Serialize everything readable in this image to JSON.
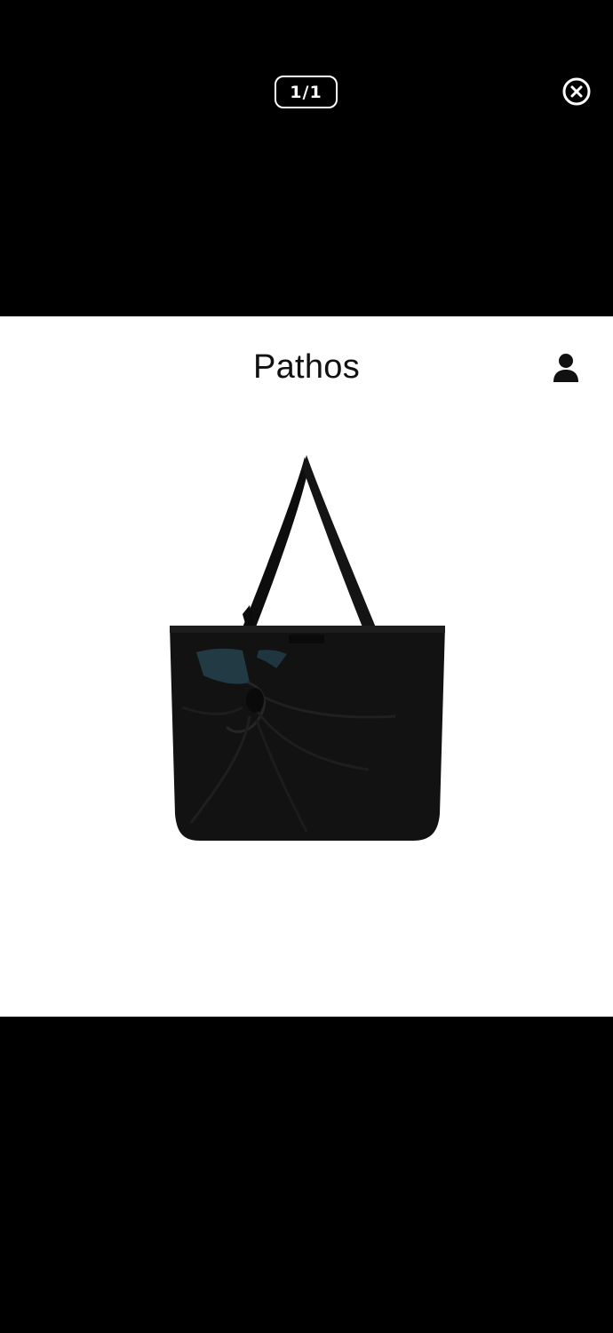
{
  "viewer": {
    "counter": "1/1",
    "close_icon": "close-circle-icon"
  },
  "panel": {
    "brand": "Pathos",
    "account_icon": "user-icon",
    "product_image": "black-tote-bag-image"
  },
  "colors": {
    "backdrop": "#000000",
    "panel": "#ffffff",
    "text": "#111111"
  }
}
